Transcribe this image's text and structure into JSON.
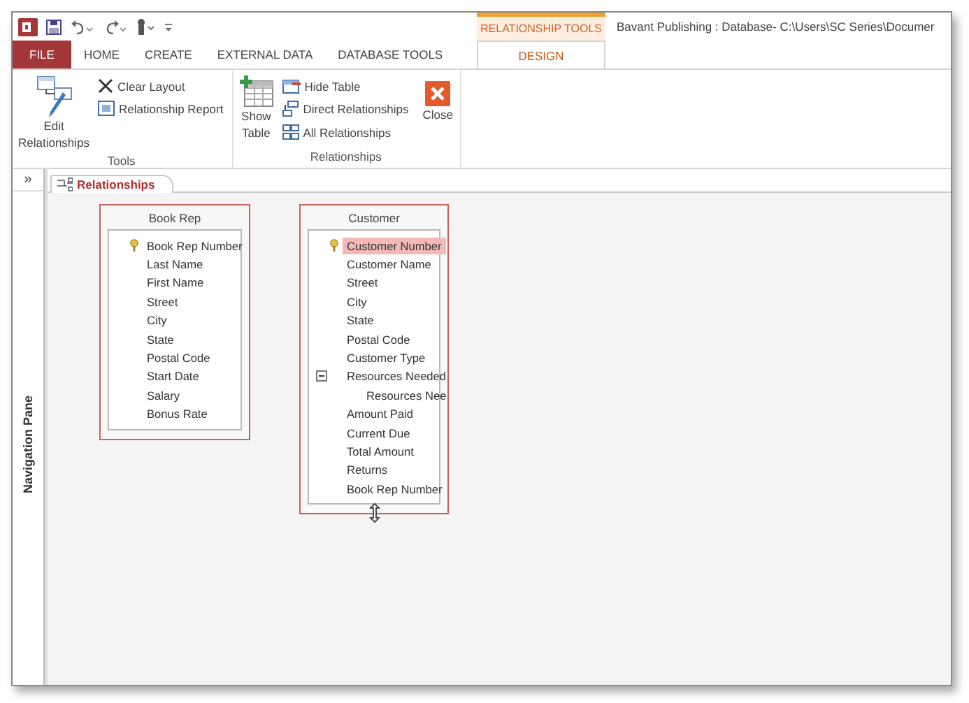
{
  "window": {
    "title": "Bavant Publishing : Database- C:\\Users\\SC Series\\Documer"
  },
  "contextual_tab_group": {
    "label": "RELATIONSHIP TOOLS"
  },
  "tabs": [
    {
      "label": "FILE",
      "kind": "file",
      "selected": false
    },
    {
      "label": "HOME",
      "kind": "normal",
      "selected": false
    },
    {
      "label": "CREATE",
      "kind": "normal",
      "selected": false
    },
    {
      "label": "EXTERNAL DATA",
      "kind": "normal",
      "selected": false
    },
    {
      "label": "DATABASE TOOLS",
      "kind": "normal",
      "selected": false
    },
    {
      "label": "DESIGN",
      "kind": "contextual",
      "selected": true
    }
  ],
  "ribbon_groups": [
    {
      "label": "Tools",
      "commands": [
        {
          "kind": "large",
          "lines": [
            "Edit",
            "Relationships"
          ]
        },
        {
          "kind": "small",
          "lines": [
            "Clear Layout"
          ]
        },
        {
          "kind": "small",
          "lines": [
            "Relationship Report"
          ]
        }
      ]
    },
    {
      "label": "Relationships",
      "commands": [
        {
          "kind": "large",
          "lines": [
            "Show",
            "Table"
          ]
        },
        {
          "kind": "small",
          "lines": [
            "Hide Table"
          ]
        },
        {
          "kind": "small",
          "lines": [
            "Direct Relationships"
          ]
        },
        {
          "kind": "small",
          "lines": [
            "All Relationships"
          ]
        },
        {
          "kind": "close",
          "lines": [
            "Close"
          ]
        }
      ]
    }
  ],
  "navigation_pane": {
    "toggle": "»",
    "label": "Navigation Pane"
  },
  "document_tabs": [
    {
      "label": "Relationships",
      "selected": true
    }
  ],
  "tables": [
    {
      "title": "Book Rep",
      "fields": [
        {
          "name": "Book Rep Number",
          "primary_key": true,
          "selected": false
        },
        {
          "name": "Last Name",
          "primary_key": false,
          "selected": false
        },
        {
          "name": "First Name",
          "primary_key": false,
          "selected": false
        },
        {
          "name": "Street",
          "primary_key": false,
          "selected": false
        },
        {
          "name": "City",
          "primary_key": false,
          "selected": false
        },
        {
          "name": "State",
          "primary_key": false,
          "selected": false
        },
        {
          "name": "Postal Code",
          "primary_key": false,
          "selected": false
        },
        {
          "name": "Start Date",
          "primary_key": false,
          "selected": false
        },
        {
          "name": "Salary",
          "primary_key": false,
          "selected": false
        },
        {
          "name": "Bonus Rate",
          "primary_key": false,
          "selected": false
        }
      ]
    },
    {
      "title": "Customer",
      "fields": [
        {
          "name": "Customer Number",
          "primary_key": true,
          "selected": true
        },
        {
          "name": "Customer Name",
          "primary_key": false,
          "selected": false
        },
        {
          "name": "Street",
          "primary_key": false,
          "selected": false
        },
        {
          "name": "City",
          "primary_key": false,
          "selected": false
        },
        {
          "name": "State",
          "primary_key": false,
          "selected": false
        },
        {
          "name": "Postal Code",
          "primary_key": false,
          "selected": false
        },
        {
          "name": "Customer Type",
          "primary_key": false,
          "selected": false
        },
        {
          "name": "Resources Needed",
          "primary_key": false,
          "selected": false,
          "expanded": true,
          "children": [
            {
              "name": "Resources Nee",
              "primary_key": false,
              "selected": false
            }
          ]
        },
        {
          "name": "Amount Paid",
          "primary_key": false,
          "selected": false
        },
        {
          "name": "Current Due",
          "primary_key": false,
          "selected": false
        },
        {
          "name": "Total Amount",
          "primary_key": false,
          "selected": false
        },
        {
          "name": "Returns",
          "primary_key": false,
          "selected": false
        },
        {
          "name": "Book Rep Number",
          "primary_key": false,
          "selected": false
        }
      ]
    }
  ]
}
